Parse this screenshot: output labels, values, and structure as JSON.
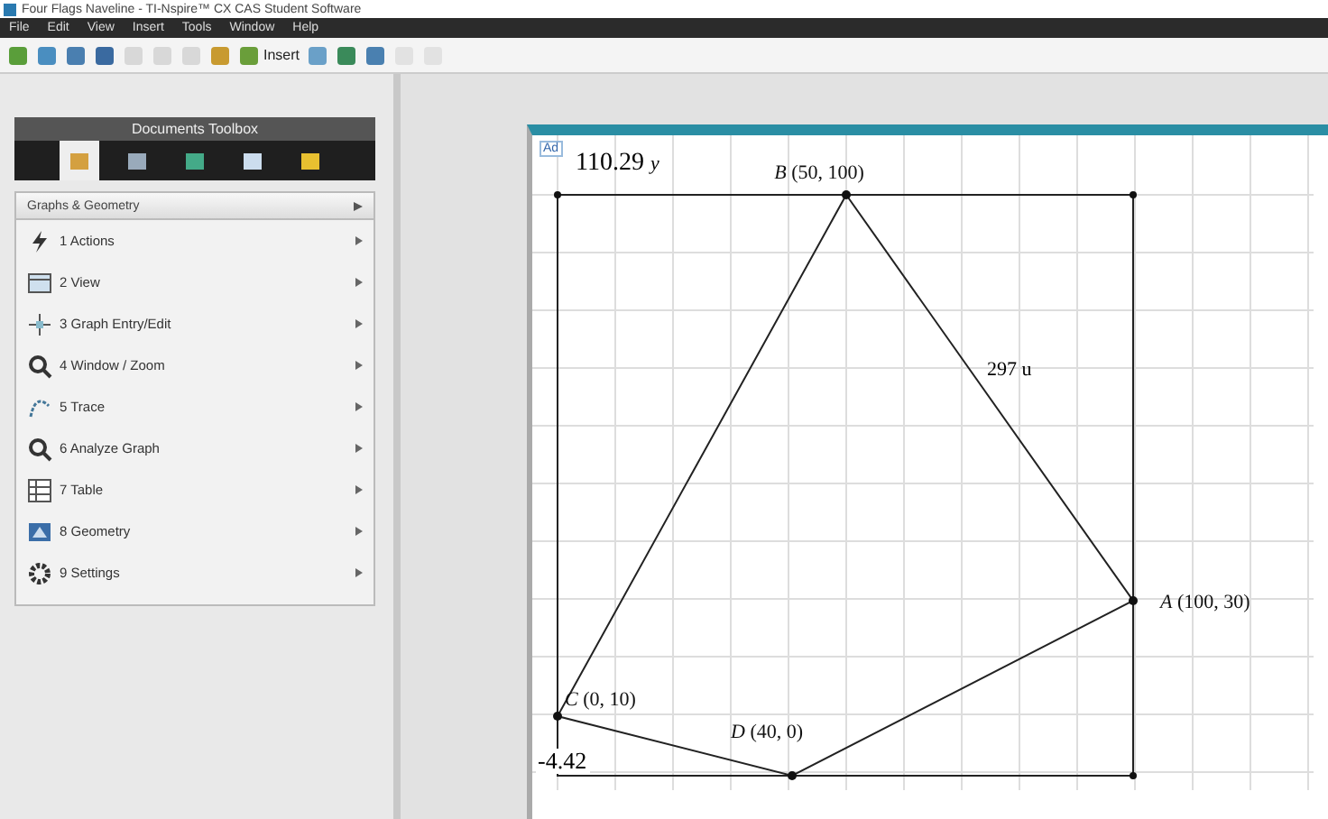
{
  "window": {
    "title": "Four Flags Naveline - TI-Nspire™ CX CAS Student Software"
  },
  "menu": [
    "File",
    "Edit",
    "View",
    "Insert",
    "Tools",
    "Window",
    "Help"
  ],
  "toolbar": [
    {
      "kind": "icon",
      "disabled": false
    },
    {
      "kind": "icon",
      "disabled": false
    },
    {
      "kind": "icon",
      "disabled": false
    },
    {
      "kind": "icon",
      "disabled": false
    },
    {
      "kind": "icon",
      "disabled": true
    },
    {
      "kind": "icon",
      "disabled": true
    },
    {
      "kind": "icon",
      "disabled": true
    },
    {
      "kind": "icon",
      "disabled": false
    },
    {
      "kind": "insert",
      "label": "Insert",
      "disabled": false
    },
    {
      "kind": "icon",
      "disabled": false
    },
    {
      "kind": "icon",
      "disabled": false
    },
    {
      "kind": "icon",
      "disabled": false
    },
    {
      "kind": "icon",
      "disabled": true
    },
    {
      "kind": "icon",
      "disabled": true
    }
  ],
  "toolbox": {
    "title": "Documents Toolbox",
    "tabs": [
      {
        "selected": true
      },
      {
        "selected": false
      },
      {
        "selected": false
      },
      {
        "selected": false
      },
      {
        "selected": false
      }
    ],
    "section": "Graphs & Geometry",
    "items": [
      {
        "label": "1 Actions"
      },
      {
        "label": "2 View"
      },
      {
        "label": "3 Graph Entry/Edit"
      },
      {
        "label": "4 Window / Zoom"
      },
      {
        "label": "5 Trace"
      },
      {
        "label": "6 Analyze Graph"
      },
      {
        "label": "7 Table"
      },
      {
        "label": "8 Geometry"
      },
      {
        "label": "9 Settings"
      }
    ]
  },
  "canvas": {
    "badge": "Ad",
    "ymax": "110.29",
    "ymax_unit": "y",
    "ymin": "-4.42",
    "points": [
      {
        "name": "B",
        "coords": "(50, 100)"
      },
      {
        "name": "A",
        "coords": "(100, 30)"
      },
      {
        "name": "C",
        "coords": "(0, 10)"
      },
      {
        "name": "D",
        "coords": "(40, 0)"
      }
    ],
    "measure": "297 u"
  }
}
